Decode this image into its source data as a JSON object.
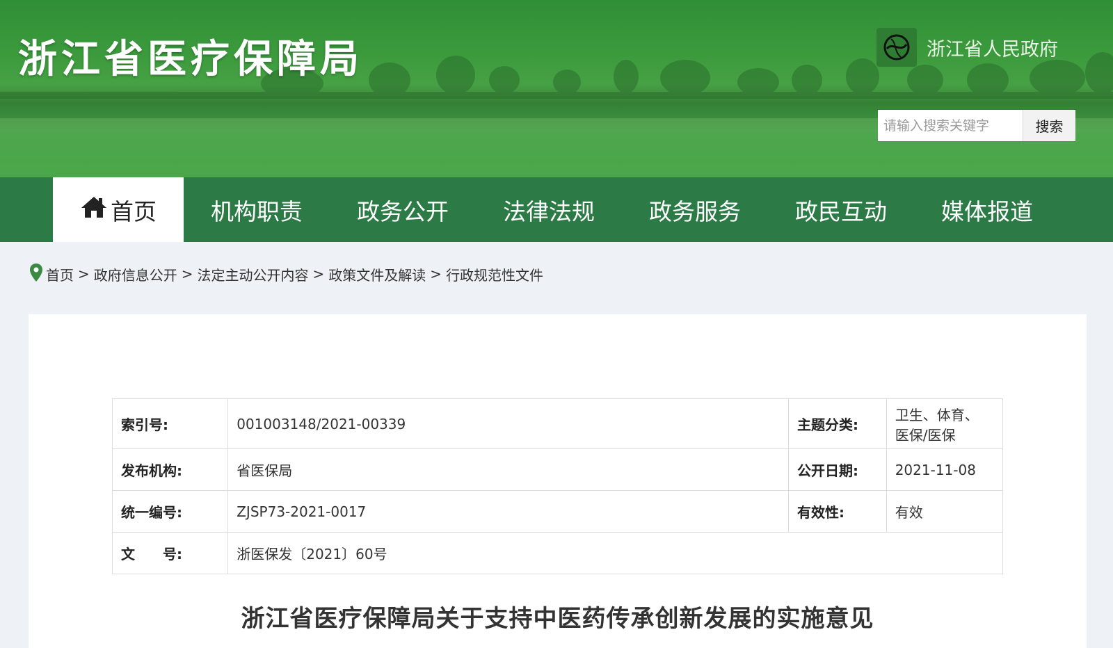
{
  "header": {
    "site_title": "浙江省医疗保障局",
    "gov_link_label": "浙江省人民政府",
    "search": {
      "placeholder": "请输入搜索关键字",
      "button_label": "搜索"
    }
  },
  "nav": {
    "items": [
      {
        "label": "首页",
        "active": true
      },
      {
        "label": "机构职责"
      },
      {
        "label": "政务公开"
      },
      {
        "label": "法律法规"
      },
      {
        "label": "政务服务"
      },
      {
        "label": "政民互动"
      },
      {
        "label": "媒体报道"
      }
    ]
  },
  "breadcrumb": {
    "items": [
      "首页",
      "政府信息公开",
      "法定主动公开内容",
      "政策文件及解读",
      "行政规范性文件"
    ],
    "separator": ">"
  },
  "meta_table": {
    "index_label": "索引号:",
    "index_value": "001003148/2021-00339",
    "topic_label": "主题分类:",
    "topic_value_line1": "卫生、体育、",
    "topic_value_line2": "医保/医保",
    "publisher_label": "发布机构:",
    "publisher_value": "省医保局",
    "date_label": "公开日期:",
    "date_value": "2021-11-08",
    "code_label": "统一编号:",
    "code_value": "ZJSP73-2021-0017",
    "validity_label": "有效性:",
    "validity_value": "有效",
    "docno_label": "文　　号:",
    "docno_value": "浙医保发〔2021〕60号"
  },
  "document": {
    "title": "浙江省医疗保障局关于支持中医药传承创新发展的实施意见"
  },
  "colors": {
    "banner_green": "#3b9a3c",
    "nav_green": "#2c7a45",
    "page_bg": "#eef1f5"
  }
}
